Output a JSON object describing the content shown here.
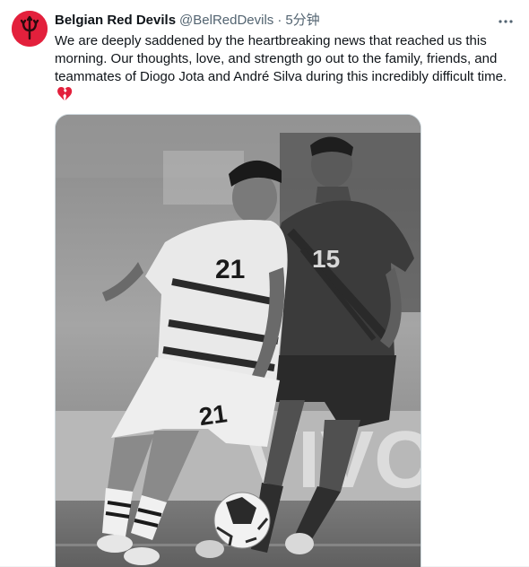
{
  "tweet": {
    "display_name": "Belgian Red Devils",
    "handle": "@BelRedDevils",
    "separator": "·",
    "time": "5分钟",
    "text": "We are deeply saddened by the heartbreaking news that reached us this morning. Our thoughts, love, and strength go out to the family, friends, and teammates of Diogo Jota and André Silva during this incredibly difficult time.",
    "emoji": "broken-heart-icon",
    "media": {
      "type": "photo",
      "jersey_number_left": "21",
      "jersey_number_right": "15"
    }
  },
  "colors": {
    "avatar_bg": "#e3203c",
    "text_primary": "#0f1419",
    "text_secondary": "#536471",
    "broken_heart": "#e3203c"
  }
}
